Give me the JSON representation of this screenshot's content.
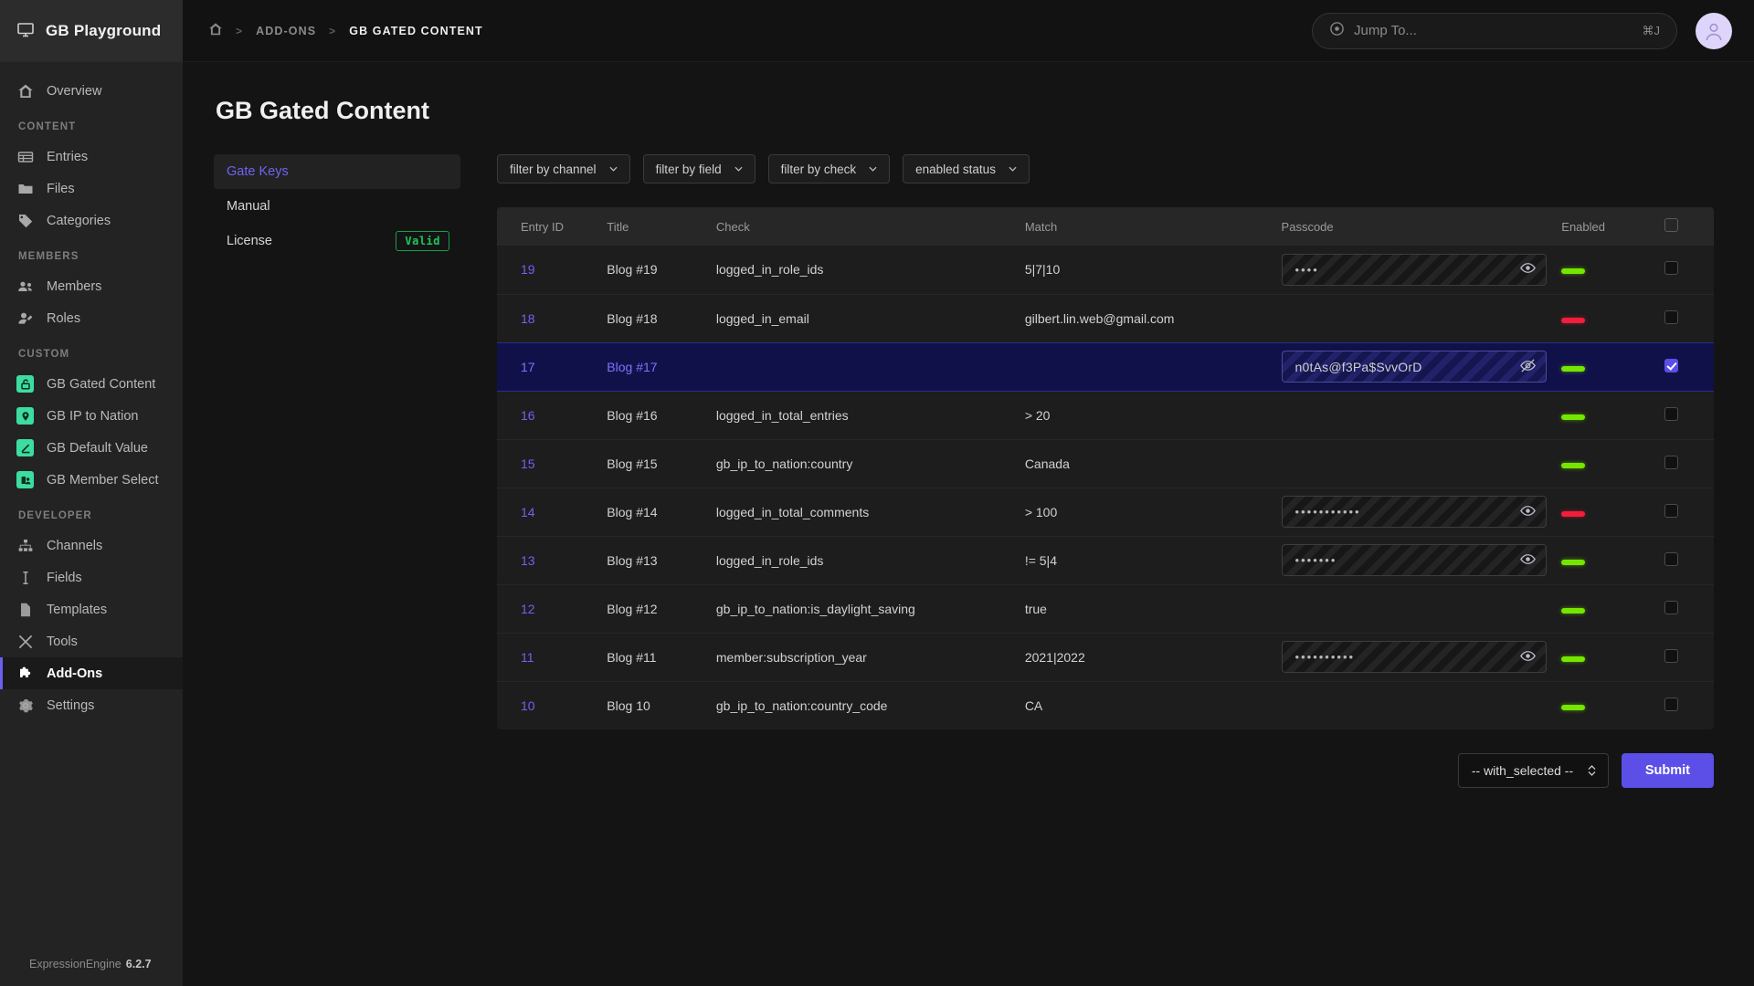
{
  "brand": {
    "name": "GB Playground",
    "icon": "monitor-icon"
  },
  "sidebar": {
    "groups": [
      {
        "label": "",
        "items": [
          {
            "label": "Overview",
            "icon": "home-icon",
            "active": false
          }
        ]
      },
      {
        "label": "CONTENT",
        "items": [
          {
            "label": "Entries",
            "icon": "table-icon",
            "active": false
          },
          {
            "label": "Files",
            "icon": "folder-icon",
            "active": false
          },
          {
            "label": "Categories",
            "icon": "tag-icon",
            "active": false
          }
        ]
      },
      {
        "label": "MEMBERS",
        "items": [
          {
            "label": "Members",
            "icon": "users-icon",
            "active": false
          },
          {
            "label": "Roles",
            "icon": "user-tag-icon",
            "active": false
          }
        ]
      },
      {
        "label": "CUSTOM",
        "items": [
          {
            "label": "GB Gated Content",
            "icon": "addon-lock-icon",
            "active": false
          },
          {
            "label": "GB IP to Nation",
            "icon": "addon-pin-icon",
            "active": false
          },
          {
            "label": "GB Default Value",
            "icon": "addon-pencil-icon",
            "active": false
          },
          {
            "label": "GB Member Select",
            "icon": "addon-member-icon",
            "active": false
          }
        ]
      },
      {
        "label": "DEVELOPER",
        "items": [
          {
            "label": "Channels",
            "icon": "sitemap-icon",
            "active": false
          },
          {
            "label": "Fields",
            "icon": "text-cursor-icon",
            "active": false
          },
          {
            "label": "Templates",
            "icon": "file-icon",
            "active": false
          },
          {
            "label": "Tools",
            "icon": "tools-icon",
            "active": false
          },
          {
            "label": "Add-Ons",
            "icon": "puzzle-icon",
            "active": true
          },
          {
            "label": "Settings",
            "icon": "gear-icon",
            "active": false
          }
        ]
      }
    ],
    "footer": {
      "product": "ExpressionEngine",
      "version": "6.2.7"
    }
  },
  "topbar": {
    "breadcrumb": [
      {
        "label": "home-icon",
        "type": "icon"
      },
      {
        "label": "ADD-ONS",
        "type": "link"
      },
      {
        "label": "GB GATED CONTENT",
        "type": "current"
      }
    ],
    "separator": ">",
    "search": {
      "placeholder": "Jump To...",
      "shortcut": "⌘J",
      "icon": "target-icon"
    },
    "avatar": "user-avatar"
  },
  "page": {
    "title": "GB Gated Content"
  },
  "subnav": {
    "items": [
      {
        "label": "Gate Keys",
        "active": true,
        "badge": null
      },
      {
        "label": "Manual",
        "active": false,
        "badge": null
      },
      {
        "label": "License",
        "active": false,
        "badge": "Valid"
      }
    ]
  },
  "filters": [
    {
      "label": "filter by channel"
    },
    {
      "label": "filter by field"
    },
    {
      "label": "filter by check"
    },
    {
      "label": "enabled status"
    }
  ],
  "table": {
    "headers": [
      "Entry ID",
      "Title",
      "Check",
      "Match",
      "Passcode",
      "Enabled",
      ""
    ],
    "rows": [
      {
        "id": "19",
        "title": "Blog #19",
        "check": "logged_in_role_ids",
        "match": "5|7|10",
        "passcode": "••••",
        "passcode_masked": true,
        "has_passcode": true,
        "eye": "eye-icon",
        "enabled": "on",
        "checked": false,
        "selected": false
      },
      {
        "id": "18",
        "title": "Blog #18",
        "check": "logged_in_email",
        "match": "gilbert.lin.web@gmail.com",
        "passcode": "",
        "passcode_masked": true,
        "has_passcode": false,
        "eye": null,
        "enabled": "off",
        "checked": false,
        "selected": false
      },
      {
        "id": "17",
        "title": "Blog #17",
        "check": "",
        "match": "",
        "passcode": "n0tAs@f3Pa$SvvOrD",
        "passcode_masked": false,
        "has_passcode": true,
        "eye": "eye-slash-icon",
        "enabled": "on",
        "checked": true,
        "selected": true
      },
      {
        "id": "16",
        "title": "Blog #16",
        "check": "logged_in_total_entries",
        "match": "> 20",
        "passcode": "",
        "passcode_masked": true,
        "has_passcode": false,
        "eye": null,
        "enabled": "on",
        "checked": false,
        "selected": false
      },
      {
        "id": "15",
        "title": "Blog #15",
        "check": "gb_ip_to_nation:country",
        "match": "Canada",
        "passcode": "",
        "passcode_masked": true,
        "has_passcode": false,
        "eye": null,
        "enabled": "on",
        "checked": false,
        "selected": false
      },
      {
        "id": "14",
        "title": "Blog #14",
        "check": "logged_in_total_comments",
        "match": "> 100",
        "passcode": "•••••••••••",
        "passcode_masked": true,
        "has_passcode": true,
        "eye": "eye-icon",
        "enabled": "off",
        "checked": false,
        "selected": false
      },
      {
        "id": "13",
        "title": "Blog #13",
        "check": "logged_in_role_ids",
        "match": "!= 5|4",
        "passcode": "•••••••",
        "passcode_masked": true,
        "has_passcode": true,
        "eye": "eye-icon",
        "enabled": "on",
        "checked": false,
        "selected": false
      },
      {
        "id": "12",
        "title": "Blog #12",
        "check": "gb_ip_to_nation:is_daylight_saving",
        "match": "true",
        "passcode": "",
        "passcode_masked": true,
        "has_passcode": false,
        "eye": null,
        "enabled": "on",
        "checked": false,
        "selected": false
      },
      {
        "id": "11",
        "title": "Blog #11",
        "check": "member:subscription_year",
        "match": "2021|2022",
        "passcode": "••••••••••",
        "passcode_masked": true,
        "has_passcode": true,
        "eye": "eye-icon",
        "enabled": "on",
        "checked": false,
        "selected": false
      },
      {
        "id": "10",
        "title": "Blog 10",
        "check": "gb_ip_to_nation:country_code",
        "match": "CA",
        "passcode": "",
        "passcode_masked": true,
        "has_passcode": false,
        "eye": null,
        "enabled": "on",
        "checked": false,
        "selected": false
      }
    ]
  },
  "actions": {
    "bulk_select_value": "-- with_selected --",
    "submit_label": "Submit"
  },
  "colors": {
    "accent": "#6f63f2",
    "submit": "#5b4fe8",
    "addon_icon_bg": "#3ddca0",
    "toggle_on": "#74e600",
    "toggle_off": "#f31d3c",
    "valid_badge": "#1dc75c",
    "selected_row": "#11114a"
  }
}
